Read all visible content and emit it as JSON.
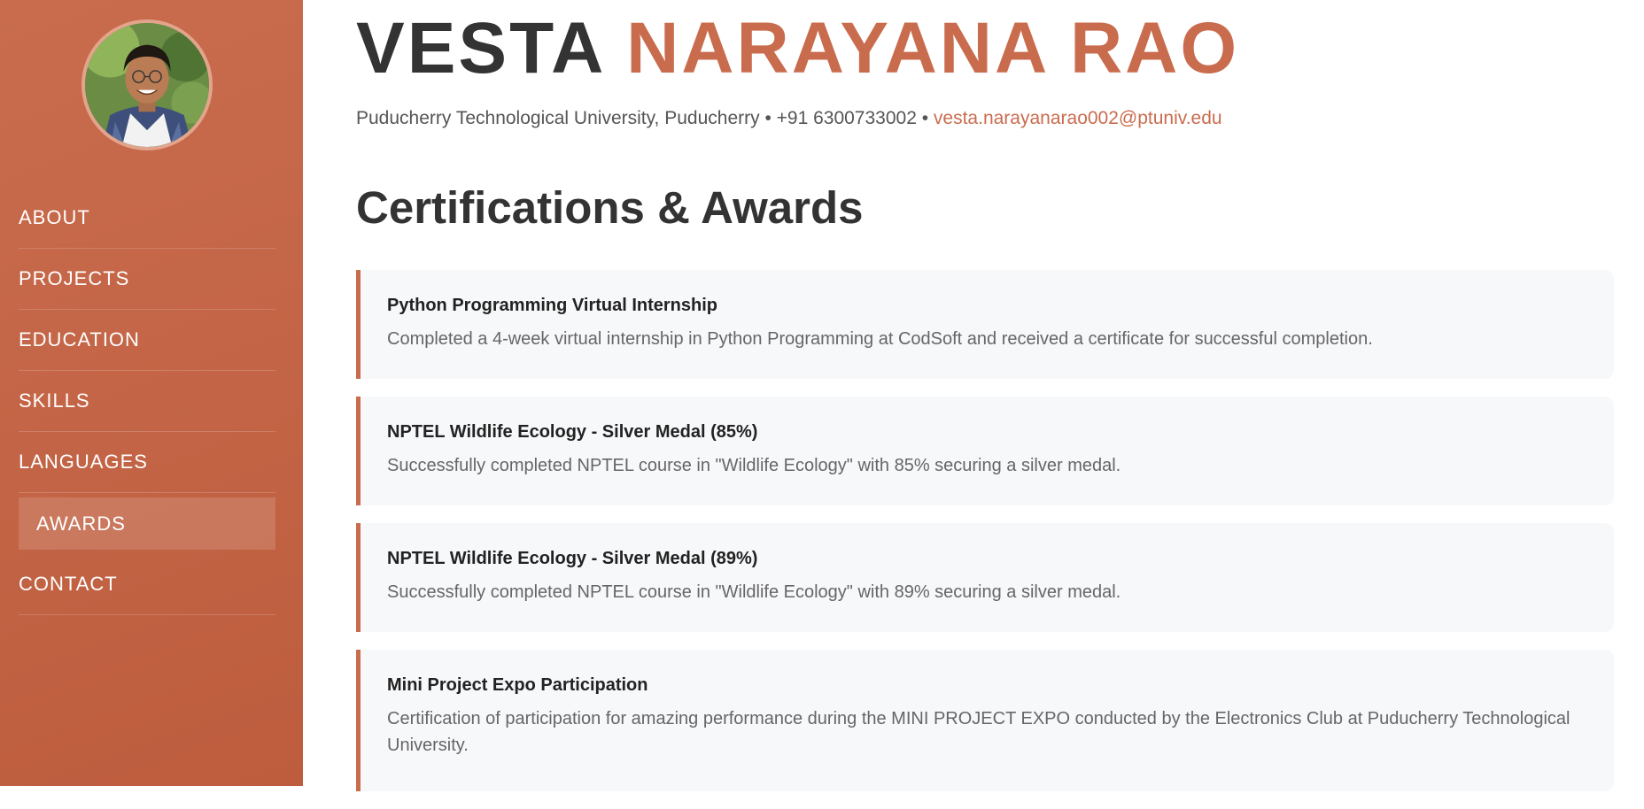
{
  "sidebar": {
    "nav": [
      {
        "label": "ABOUT"
      },
      {
        "label": "PROJECTS"
      },
      {
        "label": "EDUCATION"
      },
      {
        "label": "SKILLS"
      },
      {
        "label": "LANGUAGES"
      },
      {
        "label": "AWARDS",
        "active": true
      },
      {
        "label": "CONTACT"
      }
    ]
  },
  "header": {
    "first_name": "VESTA",
    "last_name": "NARAYANA RAO",
    "contact_text": "Puducherry Technological University, Puducherry • +91 6300733002 •",
    "email": "vesta.narayanarao002@ptuniv.edu"
  },
  "section": {
    "title": "Certifications & Awards"
  },
  "awards": [
    {
      "title": "Python Programming Virtual Internship",
      "description": "Completed a 4-week virtual internship in Python Programming at CodSoft and received a certificate for successful completion."
    },
    {
      "title": "NPTEL Wildlife Ecology - Silver Medal (85%)",
      "description": "Successfully completed NPTEL course in \"Wildlife Ecology\" with 85% securing a silver medal."
    },
    {
      "title": "NPTEL Wildlife Ecology - Silver Medal (89%)",
      "description": "Successfully completed NPTEL course in \"Wildlife Ecology\" with 89% securing a silver medal."
    },
    {
      "title": "Mini Project Expo Participation",
      "description": "Certification of participation for amazing performance during the MINI PROJECT EXPO conducted by the Electronics Club at Puducherry Technological University."
    }
  ],
  "colors": {
    "accent": "#c96c4e",
    "heading": "#333333",
    "card_bg": "#f7f8fa"
  }
}
